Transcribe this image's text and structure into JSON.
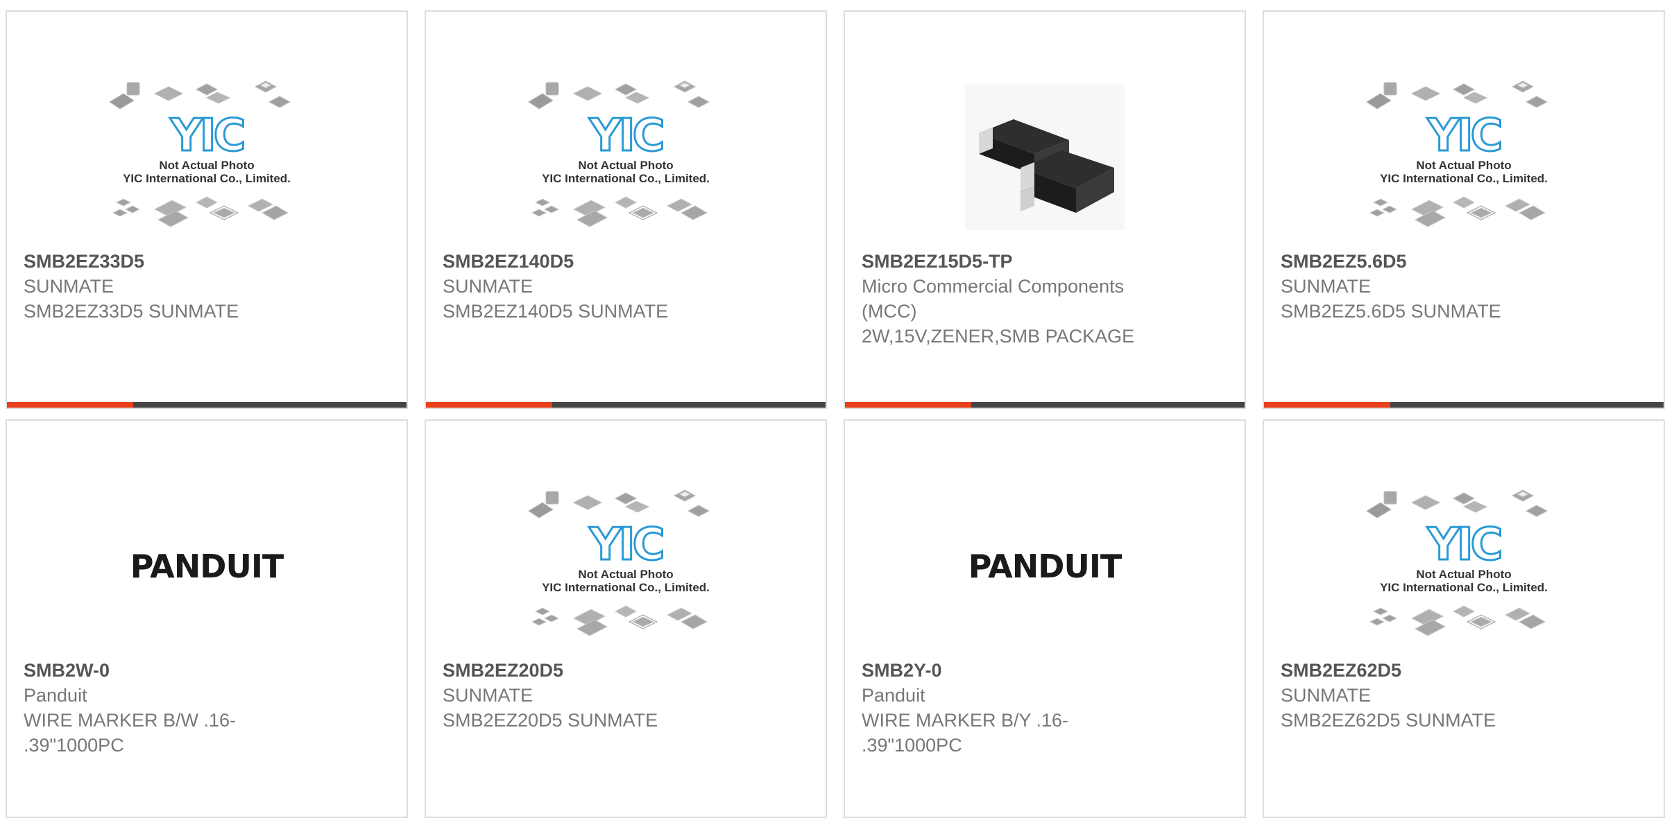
{
  "placeholder": {
    "line1": "Not Actual Photo",
    "line2": "YIC International Co., Limited.",
    "logo": "YIC"
  },
  "brand_logo": "PANDUIT",
  "colors": {
    "accent": "#e8401b",
    "bar": "#444444",
    "border": "#dcdcdc",
    "part_number": "#555555",
    "text": "#777777",
    "yic_blue": "#2a9ad6"
  },
  "products": [
    {
      "part_number": "SMB2EZ33D5",
      "manufacturer": "SUNMATE",
      "description": "SMB2EZ33D5 SUNMATE",
      "image": "not-actual-photo"
    },
    {
      "part_number": "SMB2EZ140D5",
      "manufacturer": "SUNMATE",
      "description": "SMB2EZ140D5 SUNMATE",
      "image": "not-actual-photo"
    },
    {
      "part_number": "SMB2EZ15D5-TP",
      "manufacturer": "Micro Commercial Components\n(MCC)",
      "description": "2W,15V,ZENER,SMB PACKAGE",
      "image": "smb-diode"
    },
    {
      "part_number": "SMB2EZ5.6D5",
      "manufacturer": "SUNMATE",
      "description": "SMB2EZ5.6D5 SUNMATE",
      "image": "not-actual-photo"
    },
    {
      "part_number": "SMB2W-0",
      "manufacturer": "Panduit",
      "description": "WIRE MARKER B/W .16-\n.39\"1000PC",
      "image": "panduit-logo"
    },
    {
      "part_number": "SMB2EZ20D5",
      "manufacturer": "SUNMATE",
      "description": "SMB2EZ20D5 SUNMATE",
      "image": "not-actual-photo"
    },
    {
      "part_number": "SMB2Y-0",
      "manufacturer": "Panduit",
      "description": "WIRE MARKER B/Y .16-\n.39\"1000PC",
      "image": "panduit-logo"
    },
    {
      "part_number": "SMB2EZ62D5",
      "manufacturer": "SUNMATE",
      "description": "SMB2EZ62D5 SUNMATE",
      "image": "not-actual-photo"
    }
  ]
}
